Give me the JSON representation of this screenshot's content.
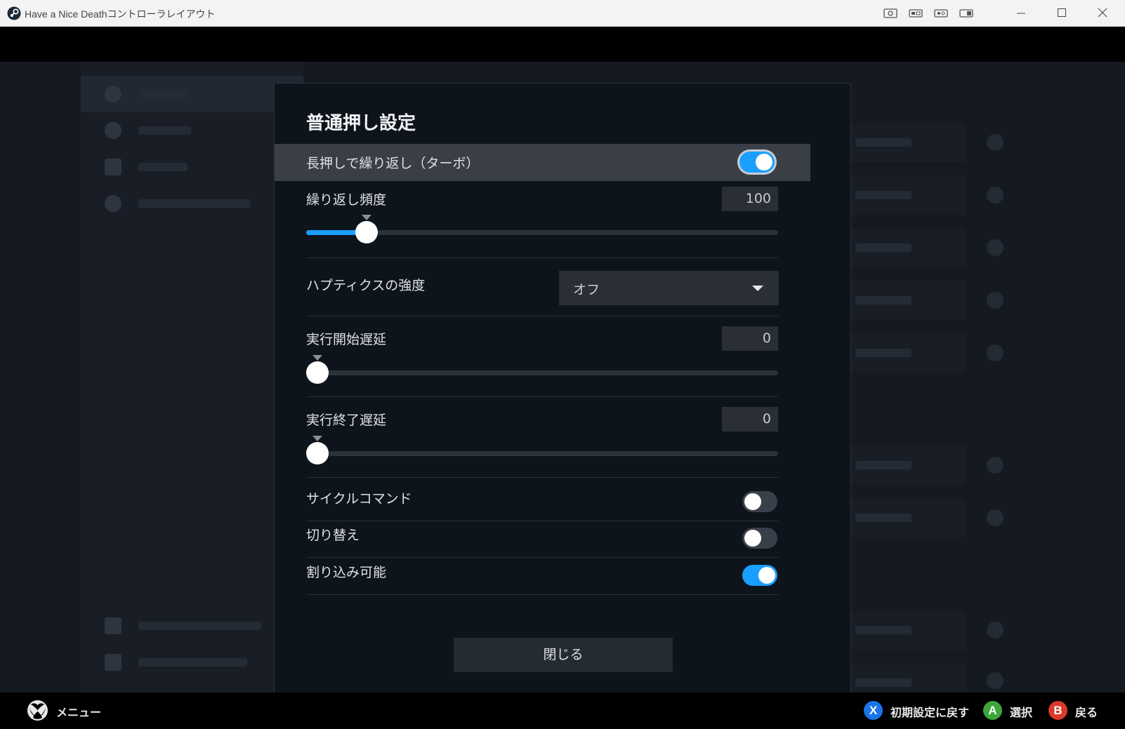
{
  "window": {
    "title": "Have a Nice Deathコントローラレイアウト"
  },
  "dialog": {
    "title": "普通押し設定",
    "turbo": {
      "label": "長押しで繰り返し（ターボ）",
      "on": true
    },
    "repeat_rate": {
      "label": "繰り返し頻度",
      "value": "100",
      "level": 0.11
    },
    "haptics": {
      "label": "ハプティクスの強度",
      "selected": "オフ"
    },
    "start_delay": {
      "label": "実行開始遅延",
      "value": "0",
      "level": 0.0
    },
    "end_delay": {
      "label": "実行終了遅延",
      "value": "0",
      "level": 0.0
    },
    "cycle_command": {
      "label": "サイクルコマンド",
      "on": false
    },
    "toggle_mode": {
      "label": "切り替え",
      "on": false
    },
    "interruptible": {
      "label": "割り込み可能",
      "on": true
    },
    "close_label": "閉じる"
  },
  "footer": {
    "menu_label": "メニュー",
    "hints": [
      {
        "button": "X",
        "label": "初期設定に戻す",
        "color": "#1a75e8"
      },
      {
        "button": "A",
        "label": "選択",
        "color": "#3ca63a"
      },
      {
        "button": "B",
        "label": "戻る",
        "color": "#d93a2b"
      }
    ]
  },
  "icons": {
    "app": "steam-icon",
    "xbox": "xbox-logo-icon"
  },
  "colors": {
    "accent": "#1a9fff",
    "dialog_bg": "#0e141b"
  }
}
